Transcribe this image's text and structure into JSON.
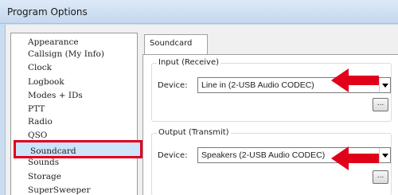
{
  "window": {
    "title": "Program Options"
  },
  "nav": {
    "items": [
      {
        "label": "Appearance"
      },
      {
        "label": "Callsign (My Info)"
      },
      {
        "label": "Clock"
      },
      {
        "label": "Logbook"
      },
      {
        "label": "Modes + IDs"
      },
      {
        "label": "PTT"
      },
      {
        "label": "Radio"
      },
      {
        "label": "QSO"
      },
      {
        "label": "Soundcard",
        "selected": true
      },
      {
        "label": "Sounds"
      },
      {
        "label": "Storage"
      },
      {
        "label": "SuperSweeper"
      }
    ]
  },
  "tabs": [
    {
      "label": "Soundcard"
    }
  ],
  "input_group": {
    "label": "Input (Receive)",
    "device_label": "Device:",
    "device_value": "Line in (2-USB Audio CODEC)",
    "browse_label": "..."
  },
  "output_group": {
    "label": "Output (Transmit)",
    "device_label": "Device:",
    "device_value": "Speakers (2-USB Audio CODEC)",
    "browse_label": "..."
  },
  "colors": {
    "highlight": "#e0001a",
    "selection": "#cde4fa"
  }
}
